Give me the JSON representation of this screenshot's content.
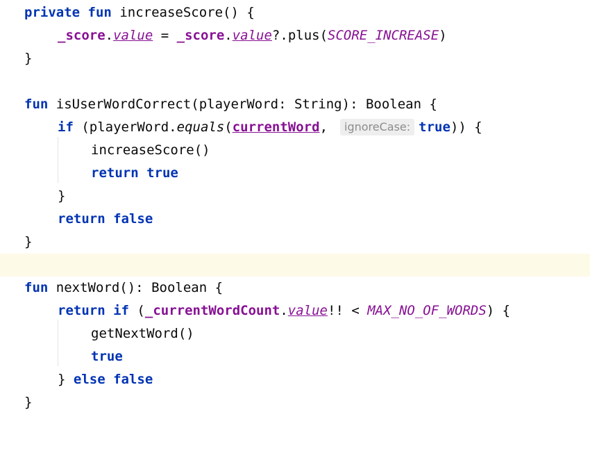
{
  "kw": {
    "private": "private",
    "fun": "fun",
    "if": "if",
    "return": "return",
    "true": "true",
    "false": "false",
    "else": "else"
  },
  "fn": {
    "increaseScore": "increaseScore",
    "isUserWordCorrect": "isUserWordCorrect",
    "nextWord": "nextWord",
    "plus": "plus",
    "equals": "equals",
    "getNextWord": "getNextWord"
  },
  "ids": {
    "score": "_score",
    "value": "value",
    "SCORE_INCREASE": "SCORE_INCREASE",
    "playerWord": "playerWord",
    "String": "String",
    "Boolean": "Boolean",
    "currentWord": "currentWord",
    "currentWordCount": "_currentWordCount",
    "MAX_NO_OF_WORDS": "MAX_NO_OF_WORDS"
  },
  "hint": {
    "ignoreCase": "ignoreCase:"
  },
  "punct": {
    "sig_empty_open": "() {",
    "close_brace": "}",
    "dot": ".",
    "eq": " = ",
    "safe_dot": "?.",
    "paren_open": "(",
    "paren_close": ")",
    "call_empty": "()",
    "sig_param_colon": ": ",
    "sig_close_ret": "): ",
    "space_brace": " {",
    "comma": ",",
    "if_close": ")) {",
    "sp_paren": " (",
    "bang_lt": "!! < ",
    "paren_brace": ") {",
    "empty_ret": "(): ",
    "sp": " ",
    "else_sep": "} "
  }
}
